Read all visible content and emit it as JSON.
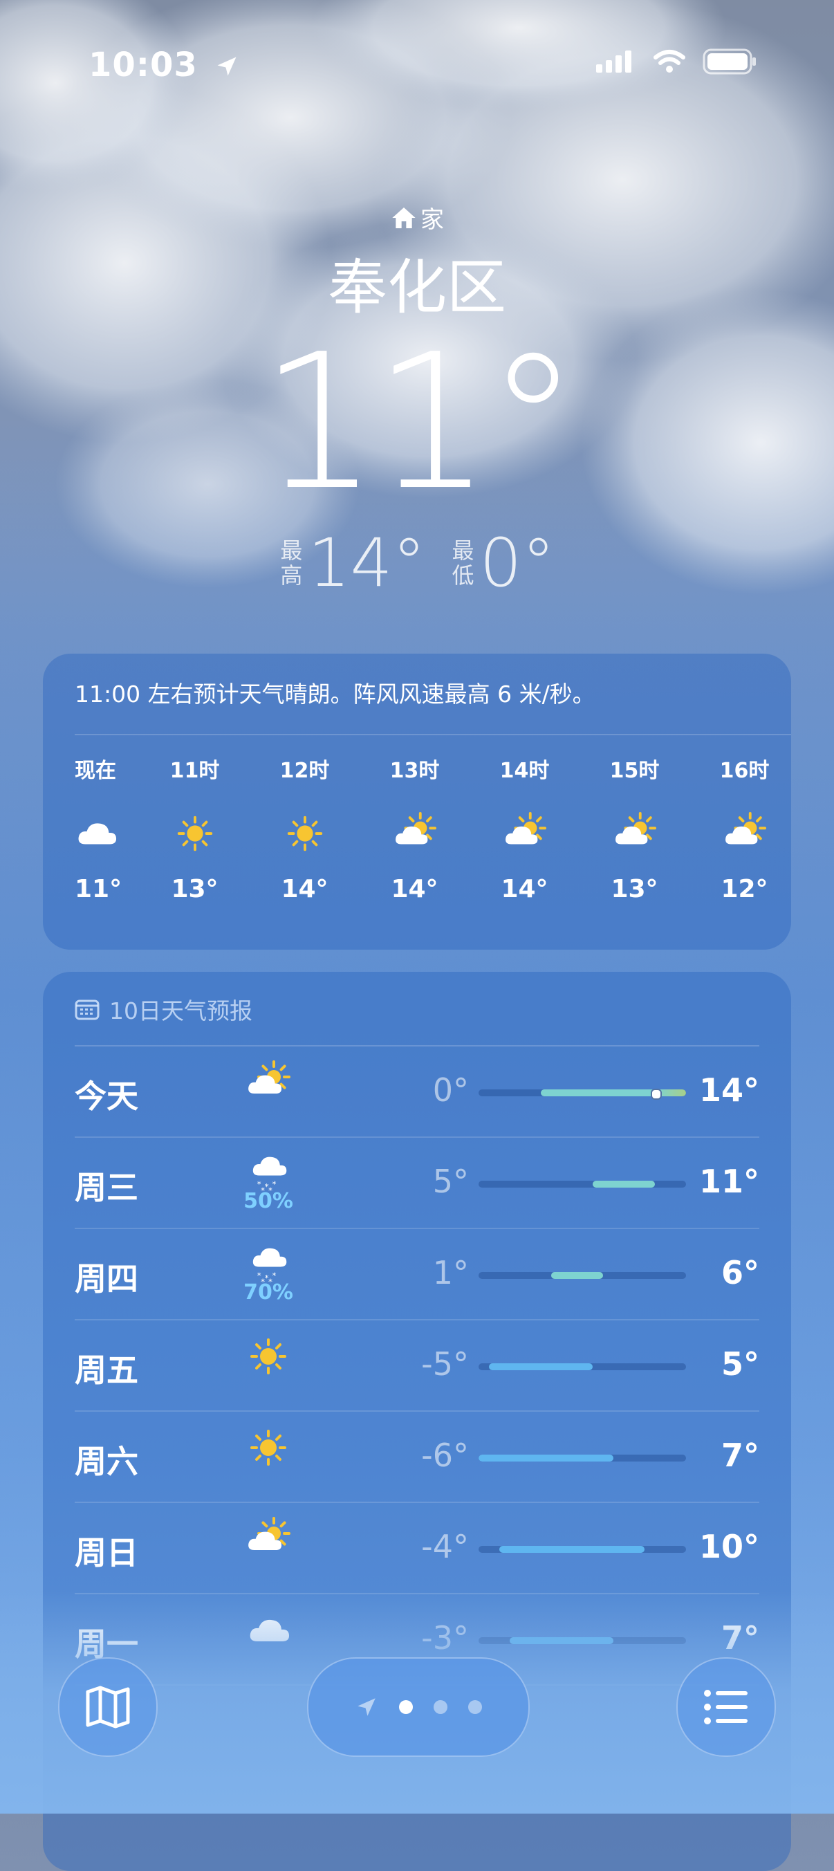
{
  "status": {
    "time": "10:03"
  },
  "hero": {
    "home_label": "家",
    "city": "奉化区",
    "temperature": "11°",
    "high_label": "最高",
    "high": "14°",
    "low_label": "最低",
    "low": "0°"
  },
  "hourly": {
    "summary": "11:00 左右预计天气晴朗。阵风风速最高 6 米/秒。",
    "hours": [
      {
        "label": "现在",
        "icon": "cloud-icon",
        "temp": "11°"
      },
      {
        "label": "11时",
        "icon": "sun-icon",
        "temp": "13°"
      },
      {
        "label": "12时",
        "icon": "sun-icon",
        "temp": "14°"
      },
      {
        "label": "13时",
        "icon": "partly-sunny-icon",
        "temp": "14°"
      },
      {
        "label": "14时",
        "icon": "partly-sunny-icon",
        "temp": "14°"
      },
      {
        "label": "15时",
        "icon": "partly-sunny-icon",
        "temp": "13°"
      },
      {
        "label": "16时",
        "icon": "partly-sunny-icon",
        "temp": "12°"
      }
    ]
  },
  "forecast": {
    "title": "10日天气预报",
    "range_min": -6,
    "range_max": 14,
    "days": [
      {
        "day": "今天",
        "icon": "partly-sunny-icon",
        "precip": "",
        "low": "0°",
        "high": "14°",
        "lo": 0,
        "hi": 14,
        "current": 11
      },
      {
        "day": "周三",
        "icon": "snow-icon",
        "precip": "50%",
        "low": "5°",
        "high": "11°",
        "lo": 5,
        "hi": 11
      },
      {
        "day": "周四",
        "icon": "snow-icon",
        "precip": "70%",
        "low": "1°",
        "high": "6°",
        "lo": 1,
        "hi": 6
      },
      {
        "day": "周五",
        "icon": "sun-icon",
        "precip": "",
        "low": "-5°",
        "high": "5°",
        "lo": -5,
        "hi": 5
      },
      {
        "day": "周六",
        "icon": "sun-icon",
        "precip": "",
        "low": "-6°",
        "high": "7°",
        "lo": -6,
        "hi": 7
      },
      {
        "day": "周日",
        "icon": "partly-sunny-icon",
        "precip": "",
        "low": "-4°",
        "high": "10°",
        "lo": -4,
        "hi": 10
      },
      {
        "day": "周一",
        "icon": "cloud-icon",
        "precip": "",
        "low": "-3°",
        "high": "7°",
        "lo": -3,
        "hi": 7
      }
    ]
  },
  "bottom_bar": {
    "pages": 3,
    "active_page": 0
  },
  "colors": {
    "sun": "#f7c531",
    "cool": "#5fb6f0",
    "teal": "#7ed3d0",
    "warm": "#a6d08a"
  }
}
